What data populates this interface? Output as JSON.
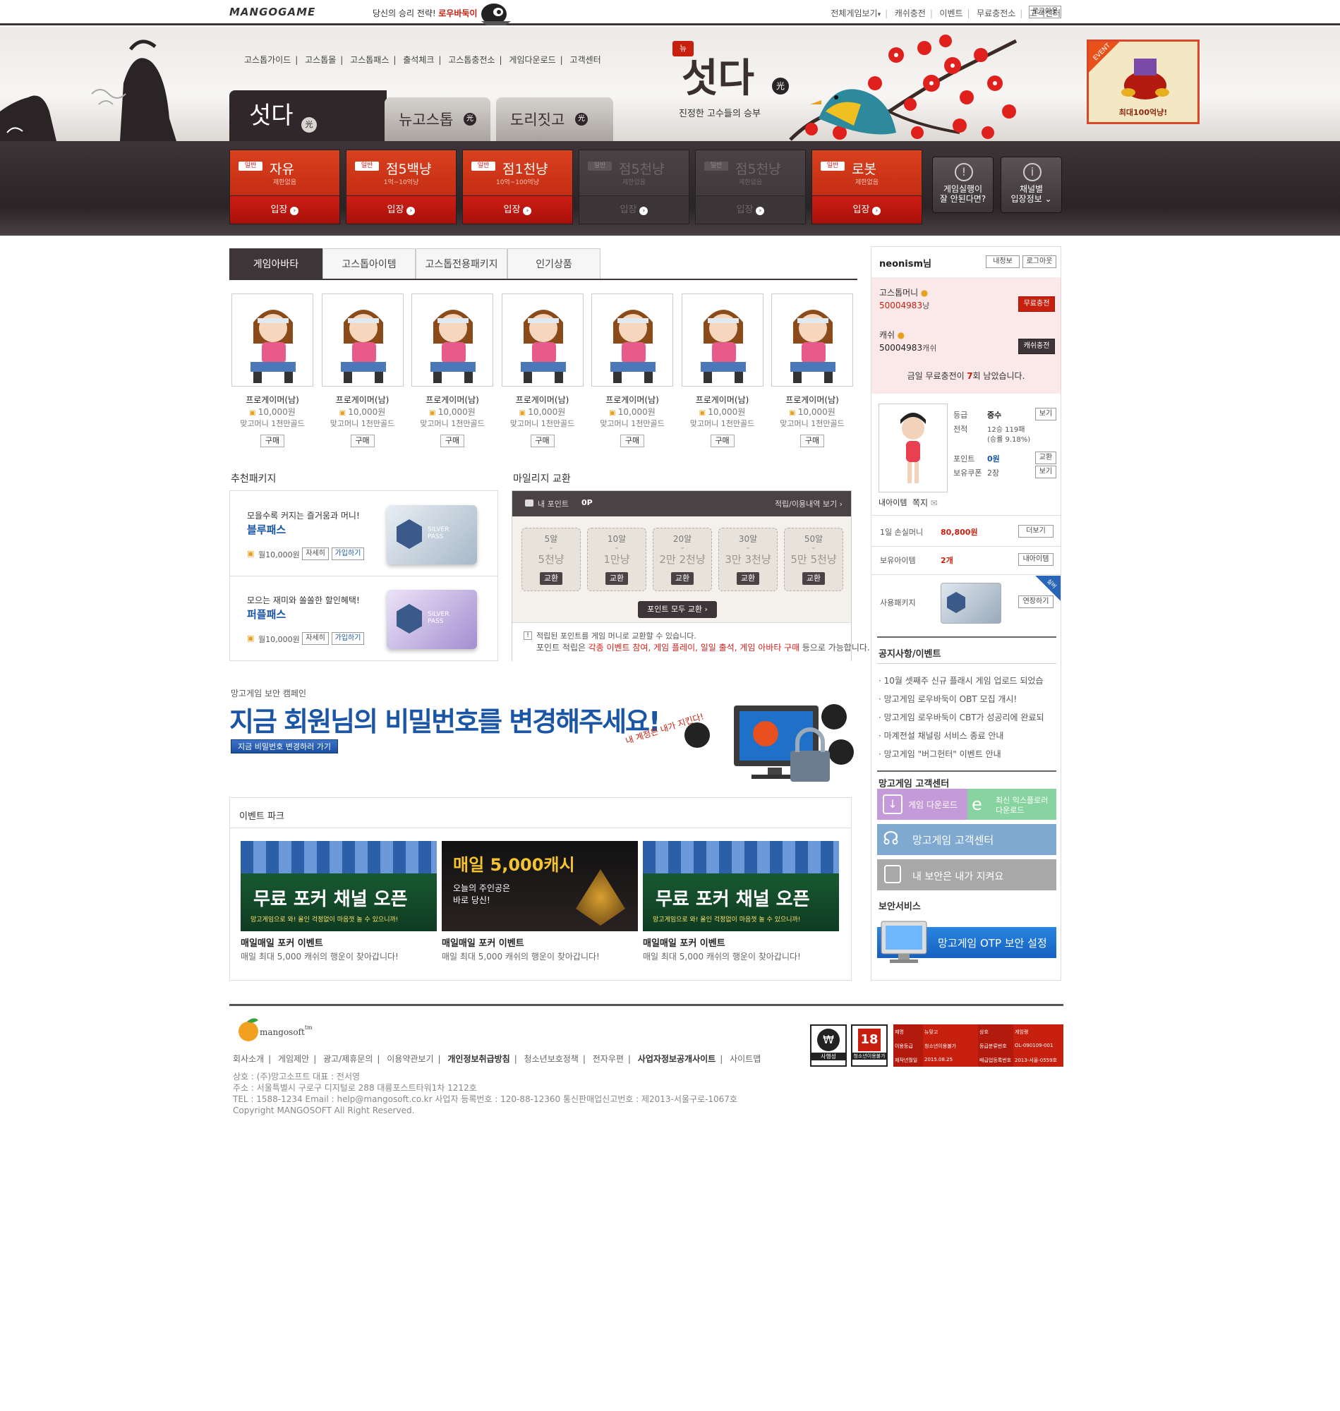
{
  "topbar": {
    "logo": "MANGOGAME",
    "promo_prefix": "당신의 승리 전략!",
    "promo_game": "로우바둑이",
    "links": [
      "전체게임보기",
      "캐쉬충전",
      "이벤트",
      "무료충전소",
      "고객센터"
    ],
    "logout": "로그아웃"
  },
  "gnb": [
    "고스톱가이드",
    "고스톱몰",
    "고스톱패스",
    "출석체크",
    "고스톱충전소",
    "게임다운로드",
    "고객센터"
  ],
  "game_tabs": [
    {
      "label": "섯다",
      "sub": "光"
    },
    {
      "label": "뉴고스톱",
      "sub": "光"
    },
    {
      "label": "도리짓고",
      "sub": "光"
    }
  ],
  "hero": {
    "new_badge": "뉴",
    "title": "섯다",
    "title_sub": "光",
    "tagline": "진정한 고수들의 승부"
  },
  "event_banner": {
    "tag": "EVENT",
    "text": "최대100억냥!"
  },
  "rooms": [
    {
      "badge": "일반",
      "name": "자유",
      "sub": "제한없음",
      "enter": "입장",
      "active": true
    },
    {
      "badge": "일반",
      "name": "점5백냥",
      "sub": "1억~10억냥",
      "enter": "입장",
      "active": true
    },
    {
      "badge": "일반",
      "name": "점1천냥",
      "sub": "10억~100억냥",
      "enter": "입장",
      "active": true
    },
    {
      "badge": "일반",
      "name": "점5천냥",
      "sub": "제한없음",
      "enter": "입장",
      "active": false
    },
    {
      "badge": "일반",
      "name": "점5천냥",
      "sub": "제한없음",
      "enter": "입장",
      "active": false
    },
    {
      "badge": "일반",
      "name": "로봇",
      "sub": "제한없음",
      "enter": "입장",
      "active": true
    }
  ],
  "side_buttons": [
    {
      "line1": "게임실행이",
      "line2": "잘 안된다면?"
    },
    {
      "line1": "채널별",
      "line2": "입장정보 ⌄"
    }
  ],
  "shop_tabs": [
    "게임아바타",
    "고스톱아이템",
    "고스톱전용패키지",
    "인기상품"
  ],
  "items": [
    {
      "name": "프로게이머(남)",
      "price": "10,000원",
      "desc": "맞고머니 1천만골드",
      "buy": "구매"
    },
    {
      "name": "프로게이머(남)",
      "price": "10,000원",
      "desc": "맞고머니 1천만골드",
      "buy": "구매"
    },
    {
      "name": "프로게이머(남)",
      "price": "10,000원",
      "desc": "맞고머니 1천만골드",
      "buy": "구매"
    },
    {
      "name": "프로게이머(남)",
      "price": "10,000원",
      "desc": "맞고머니 1천만골드",
      "buy": "구매"
    },
    {
      "name": "프로게이머(남)",
      "price": "10,000원",
      "desc": "맞고머니 1천만골드",
      "buy": "구매"
    },
    {
      "name": "프로게이머(남)",
      "price": "10,000원",
      "desc": "맞고머니 1천만골드",
      "buy": "구매"
    },
    {
      "name": "프로게이머(남)",
      "price": "10,000원",
      "desc": "맞고머니 1천만골드",
      "buy": "구매"
    }
  ],
  "packages": {
    "title": "추천패키지",
    "list": [
      {
        "tagline": "모을수록 커지는 즐거움과 머니!",
        "name": "블루패스",
        "price": "월10,000원",
        "detail": "자세히",
        "join": "가입하기",
        "card": "SILVER PASS"
      },
      {
        "tagline": "모으는 재미와 쏠쏠한 할인혜택!",
        "name": "퍼플패스",
        "price": "월10,000원",
        "detail": "자세히",
        "join": "가입하기",
        "card": "SILVER PASS"
      }
    ]
  },
  "mileage": {
    "title": "마일리지 교환",
    "my_points_label": "내 포인트",
    "my_points": "0P",
    "history_link": "적립/이용내역 보기 ›",
    "options": [
      {
        "cost": "5알",
        "reward": "5천냥",
        "btn": "교환"
      },
      {
        "cost": "10알",
        "reward": "1만냥",
        "btn": "교환"
      },
      {
        "cost": "20알",
        "reward": "2만 2천냥",
        "btn": "교환"
      },
      {
        "cost": "30알",
        "reward": "3만 3천냥",
        "btn": "교환"
      },
      {
        "cost": "50알",
        "reward": "5만 5천냥",
        "btn": "교환"
      }
    ],
    "all_btn": "포인트 모두 교환 ›",
    "note1": "적립된 포인트를 게임 머니로 교환할 수 있습니다.",
    "note2_prefix": "포인트 적립은",
    "note2_red": "각종 이벤트 참여, 게임 플레이, 일일 출석, 게임 아바타 구매",
    "note2_suffix": "등으로 가능합니다."
  },
  "security": {
    "small": "망고게임 보안 캠페인",
    "headline": "지금 회원님의 비밀번호를 변경해주세요!",
    "btn": "지금 비밀번호 변경하러 가기",
    "script": "내 계정은 내가 지킨다!"
  },
  "events": {
    "title": "이벤트 파크",
    "list": [
      {
        "banner": "무료 포커 채널 오픈",
        "banner_sub": "망고게임으로 와! 올인 걱정없이 마음껏 놀 수 있으니까!",
        "title": "매일매일 포커 이벤트",
        "desc": "매일 최대 5,000 캐쉬의 행운이 찾아갑니다!"
      },
      {
        "banner": "매일 5,000캐시",
        "banner_sub": "오늘의 주인공은 바로 당신!",
        "title": "매일매일 포커 이벤트",
        "desc": "매일 최대 5,000 캐쉬의 행운이 찾아갑니다!"
      },
      {
        "banner": "무료 포커 채널 오픈",
        "banner_sub": "망고게임으로 와! 올인 걱정없이 마음껏 놀 수 있으니까!",
        "title": "매일매일 포커 이벤트",
        "desc": "매일 최대 5,000 캐쉬의 행운이 찾아갑니다!"
      }
    ]
  },
  "user": {
    "name": "neonism님",
    "myinfo": "내정보",
    "logout": "로그아웃",
    "money_label": "고스톱머니",
    "money": "50004983",
    "money_unit": "냥",
    "free_charge": "무료충전",
    "cash_label": "캐쉬",
    "cash": "50004983",
    "cash_unit": "캐쉬",
    "cash_charge": "캐쉬충전",
    "remain_prefix": "금일 무료충전이",
    "remain_count": "7",
    "remain_suffix": "회 남았습니다.",
    "grade_label": "등급",
    "grade": "중수",
    "record_label": "전적",
    "record": "12승 119패",
    "record2": "(승률 9.18%)",
    "points_label": "포인트",
    "points": "0원",
    "coupon_label": "보유쿠폰",
    "coupon": "2장",
    "view": "보기",
    "exchange": "교환",
    "my_items": "내아이템",
    "note": "쪽지",
    "loss_label": "1일 손실머니",
    "loss": "80,800원",
    "more": "더보기",
    "items_label": "보유아이템",
    "items_count": "2개",
    "items_btn": "내아이템",
    "pkg_label": "사용패키지",
    "pkg_btn": "연장하기",
    "pkg_ribbon": "실버"
  },
  "notice": {
    "title": "공지사항/이벤트",
    "list": [
      "10월 셋째주 신규 플래시 게임 업로드 되었습",
      "망고게임 로우바둑이 OBT 모집 개시!",
      "망고게임 로우바둑이 CBT가 성공리에 완료되",
      "마계전설 채널링 서비스 종료 안내",
      "망고게임 \"버그헌터\" 이벤트 안내"
    ]
  },
  "cs": {
    "title": "망고게임 고객센터",
    "download": "게임 다운로드",
    "ie_line1": "최신 익스플로러",
    "ie_line2": "다운로드",
    "center": "망고게임 고객센터",
    "guard": "내 보안은 내가 지켜요"
  },
  "secure_service": {
    "title": "보안서비스",
    "otp": "망고게임 OTP 보안 설정"
  },
  "footer": {
    "logo": "mangosoft",
    "tm": "tm",
    "links": [
      "회사소개",
      "게임제안",
      "광고/제휴문의",
      "이용약관보기",
      "개인정보취급방침",
      "청소년보호정책",
      "전자우편",
      "사업자정보공개사이트",
      "사이트맵"
    ],
    "info": [
      "상호 : (주)망고소프트 대표 : 전서영",
      "주소 : 서울특별시 구로구 디지털로 288 대륭포스트타워1차 1212호",
      "TEL : 1588-1234 Email : help@mangosoft.co.kr 사업자 등록번호 : 120-88-12360 통신판매업신고번호 : 제2013-서울구로-1067호",
      "Copyright MANGOSOFT All Right Reserved."
    ],
    "badge1": "사행성",
    "badge2": "청소년이용불가",
    "rating_cells": [
      "제명",
      "뉴맞고",
      "상호",
      "게임랭",
      "이용등급",
      "청소년이용불가",
      "등급분류번호",
      "OL-090109-001",
      "제작년월일",
      "2015.08.25",
      "배급업등록번호",
      "2013-서울-0559호"
    ]
  },
  "colors": {
    "accent_red": "#c8200f",
    "dark": "#2d2628",
    "blue_link": "#1b56a6"
  }
}
